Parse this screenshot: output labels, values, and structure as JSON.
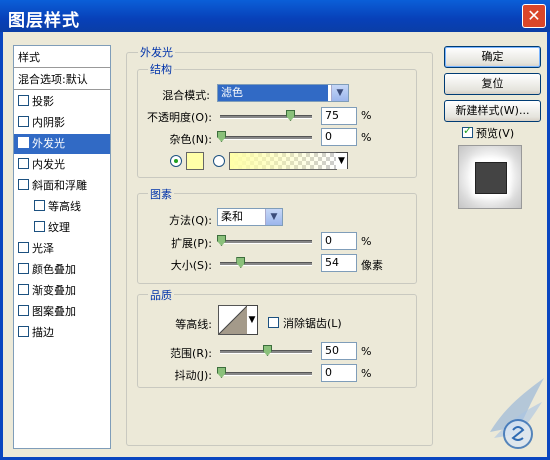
{
  "window": {
    "title": "图层样式",
    "close_symbol": "✕"
  },
  "sidebar": {
    "header": "样式",
    "blend_options": "混合选项:默认",
    "items": [
      {
        "label": "投影",
        "checked": false,
        "indent": false,
        "selected": false
      },
      {
        "label": "内阴影",
        "checked": false,
        "indent": false,
        "selected": false
      },
      {
        "label": "外发光",
        "checked": true,
        "indent": false,
        "selected": true
      },
      {
        "label": "内发光",
        "checked": false,
        "indent": false,
        "selected": false
      },
      {
        "label": "斜面和浮雕",
        "checked": false,
        "indent": false,
        "selected": false
      },
      {
        "label": "等高线",
        "checked": false,
        "indent": true,
        "selected": false
      },
      {
        "label": "纹理",
        "checked": false,
        "indent": true,
        "selected": false
      },
      {
        "label": "光泽",
        "checked": false,
        "indent": false,
        "selected": false
      },
      {
        "label": "颜色叠加",
        "checked": false,
        "indent": false,
        "selected": false
      },
      {
        "label": "渐变叠加",
        "checked": false,
        "indent": false,
        "selected": false
      },
      {
        "label": "图案叠加",
        "checked": false,
        "indent": false,
        "selected": false
      },
      {
        "label": "描边",
        "checked": false,
        "indent": false,
        "selected": false
      }
    ]
  },
  "panel": {
    "title": "外发光",
    "structure": {
      "title": "结构",
      "blend_mode_label": "混合模式:",
      "blend_mode_value": "滤色",
      "opacity_label": "不透明度(O):",
      "opacity_value": "75",
      "opacity_unit": "%",
      "noise_label": "杂色(N):",
      "noise_value": "0",
      "noise_unit": "%",
      "solid_color": "#ffffa8",
      "gradient_from": "#ffffa8",
      "color_mode": "solid"
    },
    "elements": {
      "title": "图素",
      "method_label": "方法(Q):",
      "method_value": "柔和",
      "spread_label": "扩展(P):",
      "spread_value": "0",
      "spread_unit": "%",
      "size_label": "大小(S):",
      "size_value": "54",
      "size_unit": "像素"
    },
    "quality": {
      "title": "品质",
      "contour_label": "等高线:",
      "anti_alias_label": "消除锯齿(L)",
      "anti_alias_checked": false,
      "range_label": "范围(R):",
      "range_value": "50",
      "range_unit": "%",
      "jitter_label": "抖动(J):",
      "jitter_value": "0",
      "jitter_unit": "%"
    }
  },
  "buttons": {
    "ok": "确定",
    "reset": "复位",
    "new_style": "新建样式(W)..."
  },
  "preview": {
    "label": "预览(V)",
    "checked": true
  },
  "colors": {
    "accent": "#316ac5",
    "titlebar": "#0a46c0",
    "group_label": "#0033aa"
  },
  "slider_levels": {
    "opacity": 0.75,
    "noise": 0.0,
    "spread": 0.0,
    "size": 0.21,
    "range": 0.5,
    "jitter": 0.0
  }
}
